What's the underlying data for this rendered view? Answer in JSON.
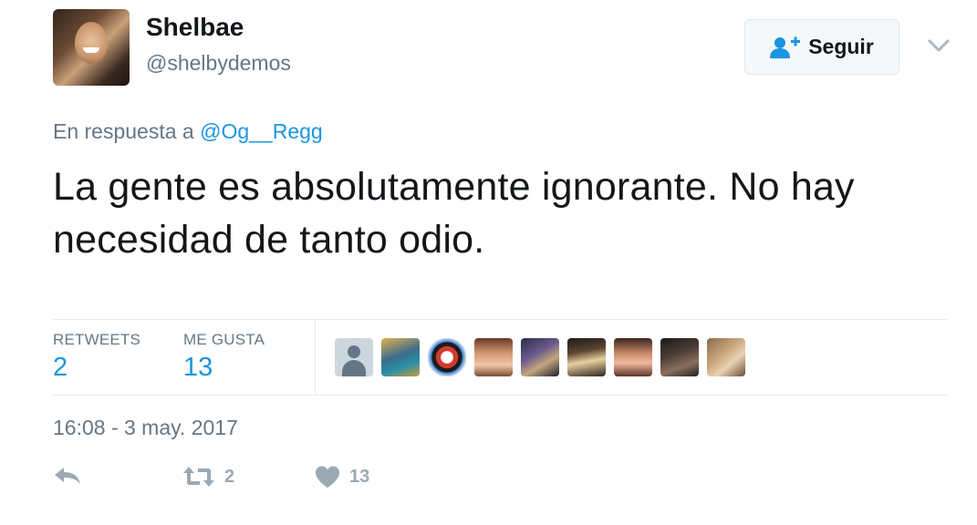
{
  "user": {
    "display_name": "Shelbae",
    "screen_name": "@shelbydemos"
  },
  "follow_button": {
    "label": "Seguir"
  },
  "reply_context": {
    "prefix": "En respuesta a",
    "mention": "@Og__Regg"
  },
  "tweet": {
    "text": "La gente es absolutamente ignorante. No hay necesidad de tanto odio."
  },
  "stats": {
    "retweets_label": "RETWEETS",
    "retweets_value": "2",
    "likes_label": "ME GUSTA",
    "likes_value": "13"
  },
  "timestamp": "16:08 - 3 may. 2017",
  "actions": {
    "retweet_count": "2",
    "like_count": "13"
  },
  "colors": {
    "link": "#1b95e0",
    "muted": "#657786",
    "icon": "#9aa9b5",
    "text": "#14171a"
  },
  "icons": [
    "follow-user-icon",
    "caret-down-icon",
    "reply-icon",
    "retweet-icon",
    "heart-icon"
  ]
}
